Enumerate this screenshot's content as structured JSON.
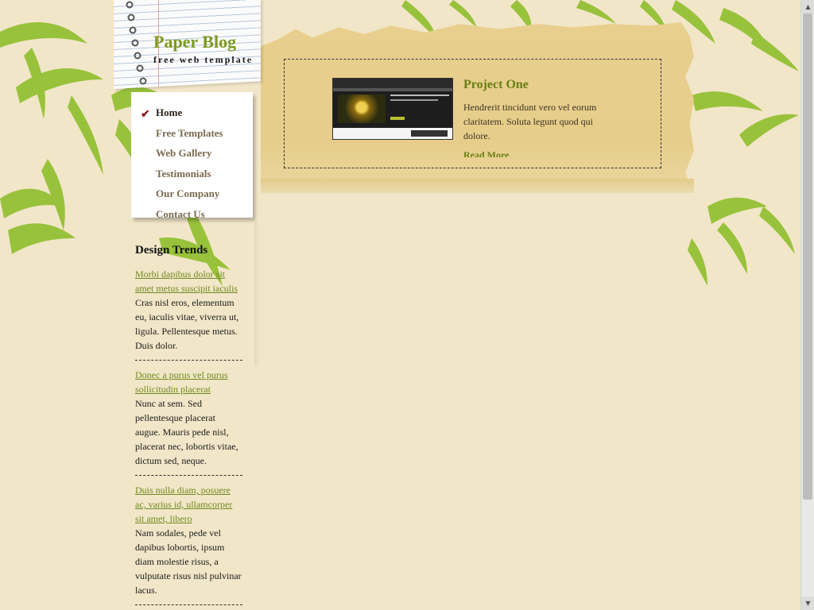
{
  "header": {
    "title": "Paper Blog",
    "tagline": "free web template"
  },
  "nav": {
    "items": [
      {
        "label": "Home",
        "active": true
      },
      {
        "label": "Free Templates",
        "active": false
      },
      {
        "label": "Web Gallery",
        "active": false
      },
      {
        "label": "Testimonials",
        "active": false
      },
      {
        "label": "Our Company",
        "active": false
      },
      {
        "label": "Contact Us",
        "active": false
      }
    ]
  },
  "sidebar": {
    "heading": "Design Trends",
    "posts": [
      {
        "link": "Morbi dapibus dolor sit amet metus suscipit iaculis",
        "text": "Cras nisl eros, elementum eu, iaculis vitae, viverra ut, ligula. Pellentesque metus. Duis dolor."
      },
      {
        "link": "Donec a purus vel purus sollicitudin placerat",
        "text": "Nunc at sem. Sed pellentesque placerat augue. Mauris pede nisl, placerat nec, lobortis vitae, dictum sed, neque."
      },
      {
        "link": "Duis nulla diam, posuere ac, varius id, ullamcorper sit amet, libero",
        "text": "Nam sodales, pede vel dapibus lobortis, ipsum diam molestie risus, a vulputate risus nisl pulvinar lacus."
      }
    ]
  },
  "featured": {
    "title": "Project One",
    "text": "Hendrerit tincidunt vero vel eorum claritatem. Soluta legunt quod qui dolore.",
    "more": "Read More"
  },
  "colors": {
    "background": "#f2e6c8",
    "paper": "#e6cd8a",
    "accent_green": "#6e8a1f",
    "logo_green": "#7c9a22",
    "check_mark": "#8a1f1f"
  },
  "icons": {
    "nav_active": "check-mark-icon",
    "scroll_up": "arrow-up-icon",
    "scroll_down": "arrow-down-icon"
  }
}
